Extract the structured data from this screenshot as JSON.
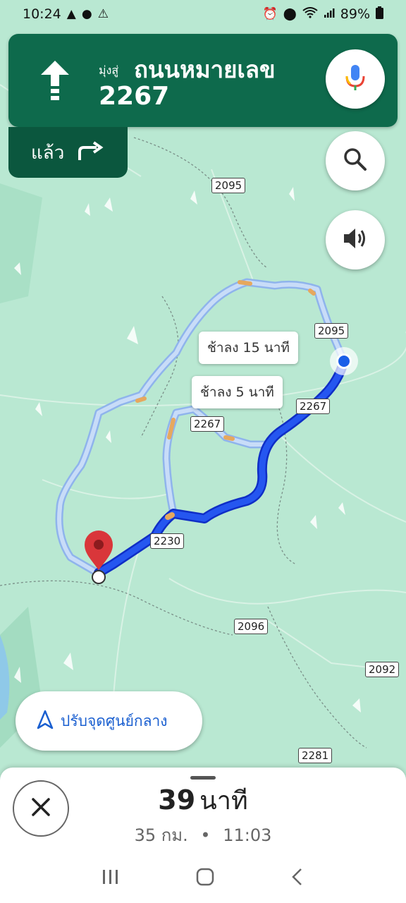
{
  "status_bar": {
    "time": "10:24",
    "battery": "89%",
    "left_icons": [
      "navigation-icon",
      "chat-icon",
      "warning-icon"
    ],
    "right_icons": [
      "alarm-icon",
      "location-icon",
      "wifi-icon",
      "signal-icon",
      "battery-icon"
    ]
  },
  "navigation": {
    "direction": "straight",
    "toward_label": "มุ่งสู่",
    "road_name": "ถนนหมายเลข",
    "road_number": "2267",
    "then_label": "แล้ว",
    "then_direction": "turn-right",
    "colors": {
      "primary": "#0e6a4c",
      "secondary": "#0b573e"
    }
  },
  "controls": {
    "mic": "mic-icon",
    "search": "search-icon",
    "sound": "volume-icon"
  },
  "map": {
    "road_labels": [
      "2095",
      "2095",
      "2267",
      "2267",
      "2230",
      "2096",
      "2092",
      "2281"
    ],
    "alt_routes": [
      {
        "label": "ช้าลง 15 นาที"
      },
      {
        "label": "ช้าลง 5 นาที"
      }
    ],
    "colors": {
      "land": "#b9e8d2",
      "route": "#1640e0",
      "alt_route": "#b4cff5",
      "traffic": "#e0a35a"
    }
  },
  "recenter": {
    "label": "ปรับจุดศูนย์กลาง"
  },
  "trip": {
    "eta_minutes": "39",
    "eta_unit": "นาที",
    "distance": "35 กม.",
    "separator": "•",
    "arrival_time": "11:03"
  }
}
